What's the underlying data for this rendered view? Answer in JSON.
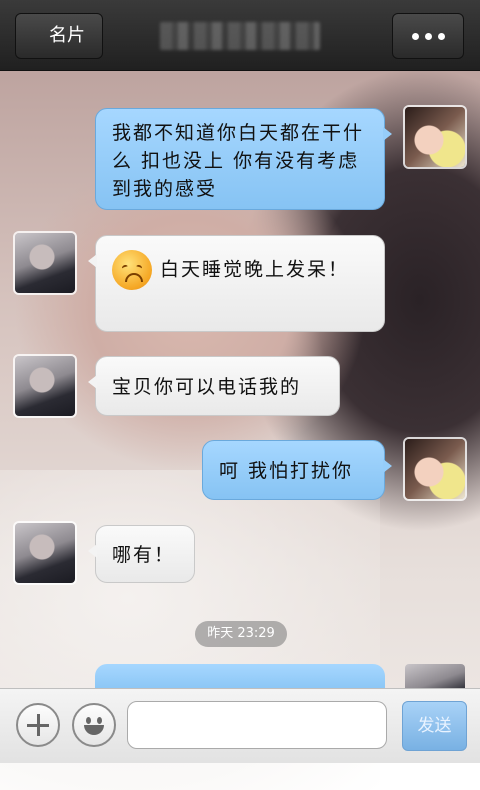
{
  "header": {
    "back_label": "名片",
    "contact_name": "",
    "more_icon": "ellipsis-icon"
  },
  "messages": [
    {
      "side": "out",
      "text": "我都不知道你白天都在干什么 扣也没上 你有没有考虑到我的感受"
    },
    {
      "side": "in",
      "emoji": "sad-face-emoji",
      "text": "白天睡觉晚上发呆！"
    },
    {
      "side": "in",
      "text": "宝贝你可以电话我的"
    },
    {
      "side": "out",
      "text": "呵 我怕打扰你"
    },
    {
      "side": "in",
      "text": "哪有！"
    }
  ],
  "timestamp": "昨天 23:29",
  "input": {
    "placeholder": "",
    "value": "",
    "send_label": "发送",
    "plus_icon": "plus-icon",
    "emoji_icon": "smiley-icon"
  },
  "colors": {
    "outgoing_bubble": "#96cdf9",
    "incoming_bubble": "#f3f3f3",
    "topbar": "#2b2b2b",
    "send_button": "#8fc1ee"
  }
}
